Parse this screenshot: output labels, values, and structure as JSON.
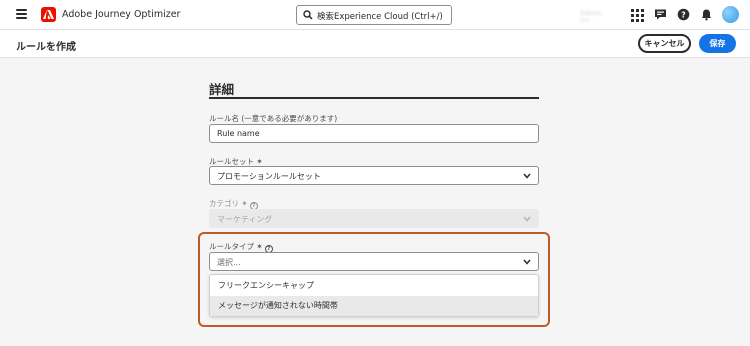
{
  "app": {
    "name": "Adobe Journey Optimizer",
    "search_placeholder": "検索Experience Cloud (Ctrl+/)",
    "org_name": "Adobe, Inc",
    "brand_color": "#eb1000",
    "accent_color": "#1473e6"
  },
  "header": {
    "title": "ルールを作成",
    "cancel_label": "キャンセル",
    "save_label": "保存"
  },
  "form": {
    "section_title": "詳細",
    "rule_name": {
      "label": "ルール名 (一意である必要があります)",
      "value": "Rule name"
    },
    "rule_set": {
      "label": "ルールセット ✶",
      "value": "プロモーションルールセット"
    },
    "category": {
      "label": "カテゴリ ✶",
      "value": "マーケティング"
    },
    "rule_type": {
      "label": "ルールタイプ ✶",
      "placeholder": "選択...",
      "options": [
        "フリークエンシーキャップ",
        "メッセージが通知されない時間帯"
      ]
    }
  },
  "icons": [
    "menu-icon",
    "adobe-logo-icon",
    "search-icon",
    "apps-grid-icon",
    "chat-icon",
    "help-icon",
    "bell-icon",
    "chevron-down-icon",
    "info-icon"
  ]
}
